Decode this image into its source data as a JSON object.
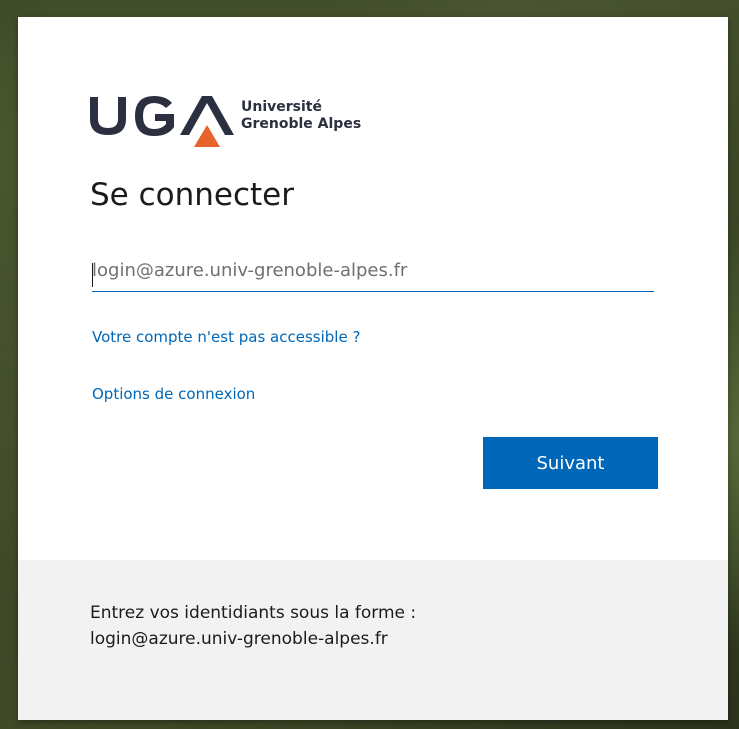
{
  "brand": {
    "logo_letters": "UGA",
    "line1": "Université",
    "line2": "Grenoble Alpes",
    "colors": {
      "navy": "#2b2f40",
      "orange": "#e8632b"
    }
  },
  "form": {
    "title": "Se connecter",
    "email_placeholder": "login@azure.univ-grenoble-alpes.fr",
    "email_value": "",
    "account_link": "Votre compte n'est pas accessible ?",
    "options_link": "Options de connexion",
    "next_button": "Suivant"
  },
  "footer": {
    "line1": "Entrez vos identidiants sous la forme :",
    "line2": "login@azure.univ-grenoble-alpes.fr"
  },
  "colors": {
    "accent": "#0067b8",
    "footer_bg": "#f2f2f2"
  }
}
